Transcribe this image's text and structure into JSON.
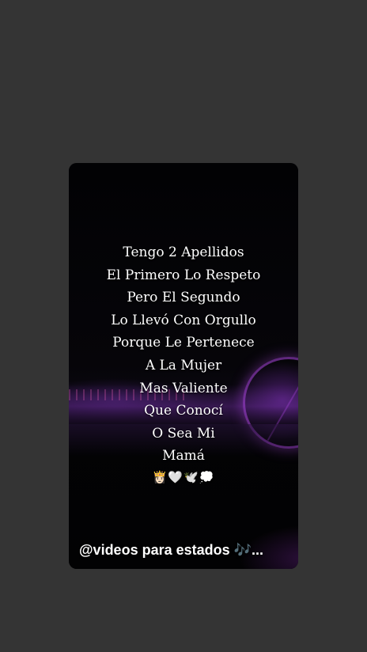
{
  "story": {
    "lines": [
      "Tengo 2 Apellidos",
      "El Primero Lo Respeto",
      "Pero El Segundo",
      "Lo Llevó Con Orgullo",
      "Porque Le Pertenece",
      "A La Mujer",
      "Mas Valiente",
      "Que Conocí",
      "O Sea Mi",
      "Mamá"
    ],
    "emojis": "👸🏻🤍🕊️💭",
    "username_text": "@videos  para estados 🎶..."
  }
}
